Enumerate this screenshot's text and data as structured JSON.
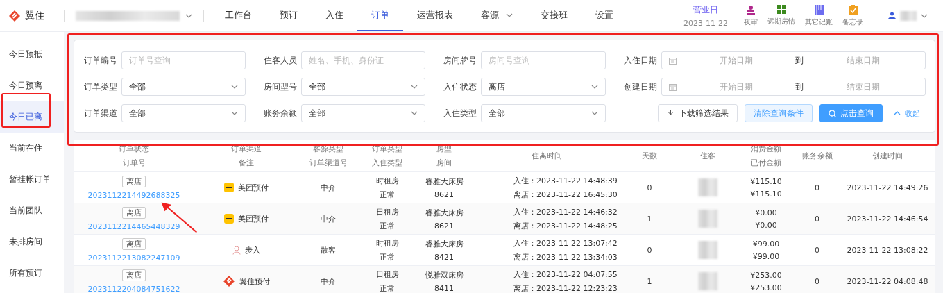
{
  "app": {
    "name": "翼住"
  },
  "nav": [
    {
      "label": "工作台",
      "selected": false,
      "dropdown": false
    },
    {
      "label": "预订",
      "selected": false,
      "dropdown": false
    },
    {
      "label": "入住",
      "selected": false,
      "dropdown": false
    },
    {
      "label": "订单",
      "selected": true,
      "dropdown": false
    },
    {
      "label": "运营报表",
      "selected": false,
      "dropdown": false
    },
    {
      "label": "客源",
      "selected": false,
      "dropdown": true
    },
    {
      "label": "交接班",
      "selected": false,
      "dropdown": false
    },
    {
      "label": "设置",
      "selected": false,
      "dropdown": false
    }
  ],
  "business_day": {
    "label": "营业日",
    "date": "2023-11-22"
  },
  "tools": [
    {
      "label": "夜审",
      "kind": "stamp"
    },
    {
      "label": "远期房情",
      "kind": "grid"
    },
    {
      "label": "其它记账",
      "kind": "book"
    },
    {
      "label": "备忘录",
      "kind": "clipboard"
    }
  ],
  "sidebar": [
    {
      "label": "今日预抵",
      "selected": false
    },
    {
      "label": "今日预离",
      "selected": false
    },
    {
      "label": "今日已离",
      "selected": true
    },
    {
      "label": "当前在住",
      "selected": false
    },
    {
      "label": "暂挂帐订单",
      "selected": false
    },
    {
      "label": "当前团队",
      "selected": false
    },
    {
      "label": "未排房间",
      "selected": false
    },
    {
      "label": "所有预订",
      "selected": false
    }
  ],
  "filters": [
    {
      "label": "订单编号",
      "kind": "text",
      "placeholder": "订单号查询"
    },
    {
      "label": "住客人员",
      "kind": "text",
      "placeholder": "姓名、手机、身份证"
    },
    {
      "label": "房间牌号",
      "kind": "text",
      "placeholder": "房间号查询"
    },
    {
      "label": "入住日期",
      "kind": "daterange",
      "start_placeholder": "开始日期",
      "separator": "到",
      "end_placeholder": "结束日期"
    },
    {
      "label": "订单类型",
      "kind": "select",
      "value": "全部"
    },
    {
      "label": "房间型号",
      "kind": "select",
      "value": "全部"
    },
    {
      "label": "入住状态",
      "kind": "select",
      "value": "离店"
    },
    {
      "label": "创建日期",
      "kind": "daterange",
      "start_placeholder": "开始日期",
      "separator": "到",
      "end_placeholder": "结束日期"
    },
    {
      "label": "订单渠道",
      "kind": "select",
      "value": "全部"
    },
    {
      "label": "账务余额",
      "kind": "select",
      "value": "全部"
    },
    {
      "label": "入住类型",
      "kind": "select",
      "value": "全部"
    }
  ],
  "actions": {
    "download": "下载筛选结果",
    "clear": "清除查询条件",
    "search": "点击查询",
    "collapse": "收起"
  },
  "table": {
    "columns": [
      {
        "line1": "订单状态",
        "line2": "订单号"
      },
      {
        "line1": "订单渠道",
        "line2": "备注"
      },
      {
        "line1": "客源类型",
        "line2": "订单渠道号"
      },
      {
        "line1": "订单类型",
        "line2": "入住类型"
      },
      {
        "line1": "房型",
        "line2": "房间"
      },
      {
        "line1": "住离时间"
      },
      {
        "line1": "天数"
      },
      {
        "line1": "住客"
      },
      {
        "line1": "消费金额",
        "line2": "已付金额"
      },
      {
        "line1": "账务余额"
      },
      {
        "line1": "创建时间"
      }
    ],
    "rows": [
      {
        "status": "离店",
        "order_no": "2023112214492688325",
        "channel": {
          "kind": "meituan",
          "label": "美团预付"
        },
        "source": "中介",
        "order_type": "时租房",
        "checkin_type": "正常",
        "room_type": "睿雅大床房",
        "room": "8621",
        "checkin": "入住：2023-11-22 14:48:39",
        "checkout": "离店：2023-11-22 16:45:30",
        "days": "0",
        "consumed": "¥115.10",
        "paid": "¥115.10",
        "balance": "0",
        "created": "2023-11-22 14:49:26"
      },
      {
        "status": "离店",
        "order_no": "2023112214465448329",
        "channel": {
          "kind": "meituan",
          "label": "美团预付"
        },
        "source": "中介",
        "order_type": "日租房",
        "checkin_type": "正常",
        "room_type": "睿雅大床房",
        "room": "8621",
        "checkin": "入住：2023-11-22 14:46:32",
        "checkout": "离店：2023-11-22 14:48:25",
        "days": "1",
        "consumed": "¥0.00",
        "paid": "¥0.00",
        "balance": "0",
        "created": "2023-11-22 14:46:54"
      },
      {
        "status": "离店",
        "order_no": "2023112213082247109",
        "channel": {
          "kind": "walkin",
          "label": "步入"
        },
        "source": "散客",
        "order_type": "时租房",
        "checkin_type": "正常",
        "room_type": "睿雅大床房",
        "room": "8421",
        "checkin": "入住：2023-11-22 13:07:42",
        "checkout": "离店：2023-11-22 13:34:03",
        "days": "0",
        "consumed": "¥99.00",
        "paid": "¥99.00",
        "balance": "0",
        "created": "2023-11-22 13:08:22"
      },
      {
        "status": "离店",
        "order_no": "2023112204084751622",
        "channel": {
          "kind": "yizhu",
          "label": "翼住预付"
        },
        "source": "中介",
        "order_type": "日租房",
        "checkin_type": "正常",
        "room_type": "悦雅双床房",
        "room": "8411",
        "checkin": "入住：2023-11-22 04:07:55",
        "checkout": "离店：2023-11-22 12:23:23",
        "days": "1",
        "consumed": "¥253.00",
        "paid": "¥253.00",
        "balance": "0",
        "created": "2023-11-22 04:08:48"
      }
    ]
  }
}
